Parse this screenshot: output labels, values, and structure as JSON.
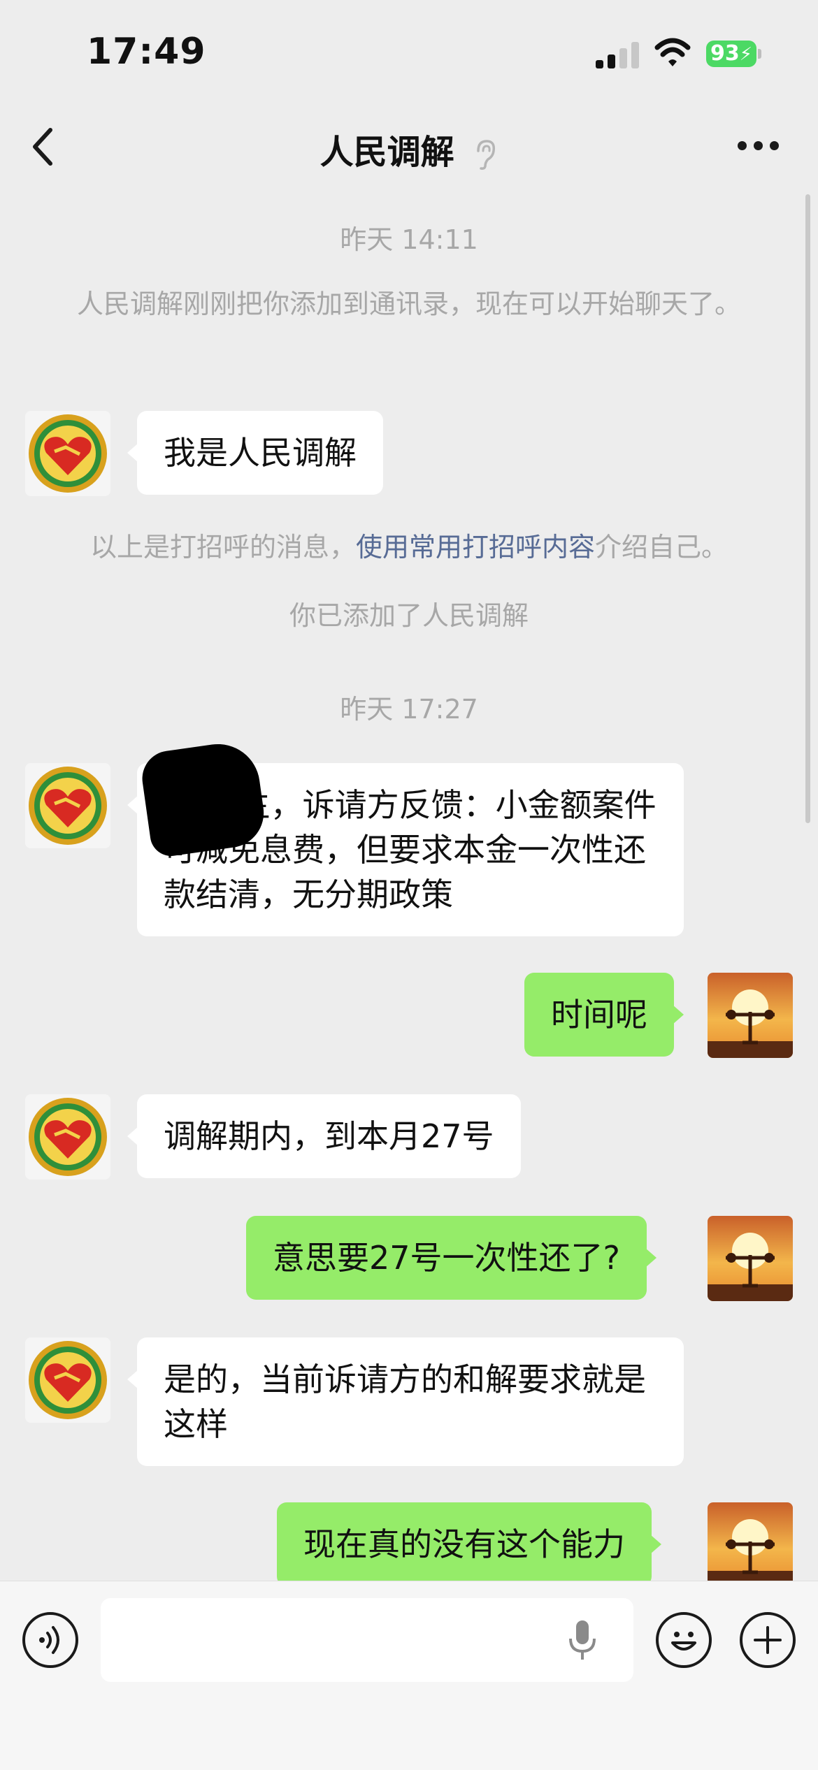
{
  "status": {
    "time": "17:49",
    "battery": "93"
  },
  "nav": {
    "title": "人民调解"
  },
  "system": {
    "ts1": "昨天 14:11",
    "added_notice": "人民调解刚刚把你添加到通讯录，现在可以开始聊天了。",
    "greeting_prefix": "以上是打招呼的消息，",
    "greeting_link": "使用常用打招呼内容",
    "greeting_suffix": "介绍自己。",
    "you_added": "你已添加了人民调解",
    "ts2": "昨天 17:27"
  },
  "messages": [
    {
      "side": "left",
      "text": "我是人民调解"
    },
    {
      "side": "left",
      "text": "张  先生，诉请方反馈：小金额案件可减免息费，但要求本金一次性还款结清，无分期政策"
    },
    {
      "side": "right",
      "text": "时间呢"
    },
    {
      "side": "left",
      "text": "调解期内，到本月27号"
    },
    {
      "side": "right",
      "text": "意思要27号一次性还了?"
    },
    {
      "side": "left",
      "text": "是的，当前诉请方的和解要求就是这样"
    },
    {
      "side": "right",
      "text": "现在真的没有这个能力"
    }
  ],
  "colors": {
    "background": "#ededed",
    "sent_bubble": "#95ec69",
    "received_bubble": "#ffffff",
    "link": "#576b95"
  }
}
